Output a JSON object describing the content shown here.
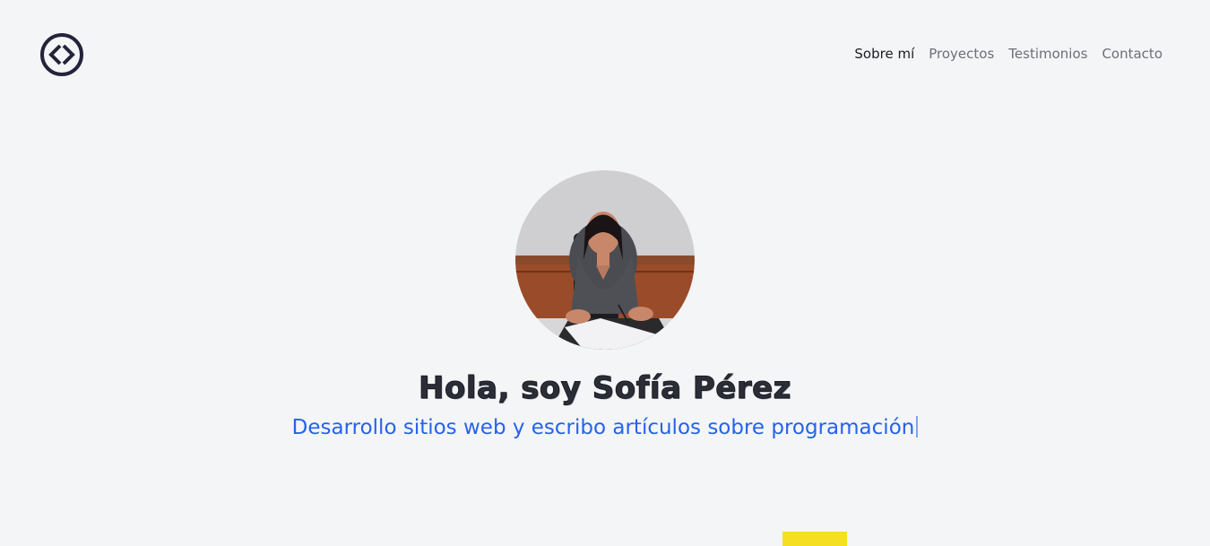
{
  "nav": {
    "logo_icon": "code-brackets-icon",
    "links": [
      {
        "label": "Sobre mí",
        "active": true
      },
      {
        "label": "Proyectos",
        "active": false
      },
      {
        "label": "Testimonios",
        "active": false
      },
      {
        "label": "Contacto",
        "active": false
      }
    ]
  },
  "hero": {
    "avatar_icon": "profile-photo",
    "title": "Hola, soy Sofía Pérez",
    "subtitle": "Desarrollo sitios web y escribo artículos sobre programación"
  },
  "colors": {
    "background": "#f4f5f7",
    "accent": "#2563eb",
    "highlight": "#f5df22",
    "text_dark": "#1c1c22"
  }
}
